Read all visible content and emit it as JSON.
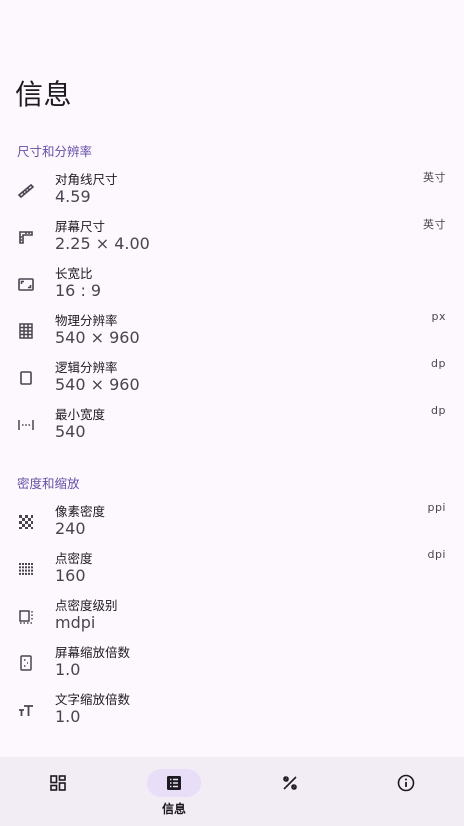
{
  "page": {
    "title": "信息"
  },
  "sections": [
    {
      "header": "尺寸和分辨率",
      "items": [
        {
          "icon": "ruler-diagonal-icon",
          "label": "对角线尺寸",
          "value": "4.59",
          "unit": "英寸"
        },
        {
          "icon": "ruler-corner-icon",
          "label": "屏幕尺寸",
          "value": "2.25 × 4.00",
          "unit": "英寸"
        },
        {
          "icon": "aspect-ratio-icon",
          "label": "长宽比",
          "value": "16 : 9",
          "unit": ""
        },
        {
          "icon": "grid-icon",
          "label": "物理分辨率",
          "value": "540 × 960",
          "unit": "px"
        },
        {
          "icon": "rectangle-icon",
          "label": "逻辑分辨率",
          "value": "540 × 960",
          "unit": "dp"
        },
        {
          "icon": "width-icon",
          "label": "最小宽度",
          "value": "540",
          "unit": "dp"
        }
      ]
    },
    {
      "header": "密度和缩放",
      "items": [
        {
          "icon": "checkerboard-icon",
          "label": "像素密度",
          "value": "240",
          "unit": "ppi"
        },
        {
          "icon": "dots-grid-icon",
          "label": "点密度",
          "value": "160",
          "unit": "dpi"
        },
        {
          "icon": "density-level-icon",
          "label": "点密度级别",
          "value": "mdpi",
          "unit": ""
        },
        {
          "icon": "screen-scale-icon",
          "label": "屏幕缩放倍数",
          "value": "1.0",
          "unit": ""
        },
        {
          "icon": "text-size-icon",
          "label": "文字缩放倍数",
          "value": "1.0",
          "unit": ""
        }
      ]
    }
  ],
  "bottom_nav": {
    "items": [
      {
        "icon": "dashboard-icon",
        "label": "",
        "active": false
      },
      {
        "icon": "list-icon",
        "label": "信息",
        "active": true
      },
      {
        "icon": "tools-icon",
        "label": "",
        "active": false
      },
      {
        "icon": "about-icon",
        "label": "",
        "active": false
      }
    ]
  },
  "colors": {
    "accent": "#6750a4",
    "background": "#fdf7fe",
    "nav_background": "#f2ecf4",
    "nav_active": "#e8def8"
  }
}
